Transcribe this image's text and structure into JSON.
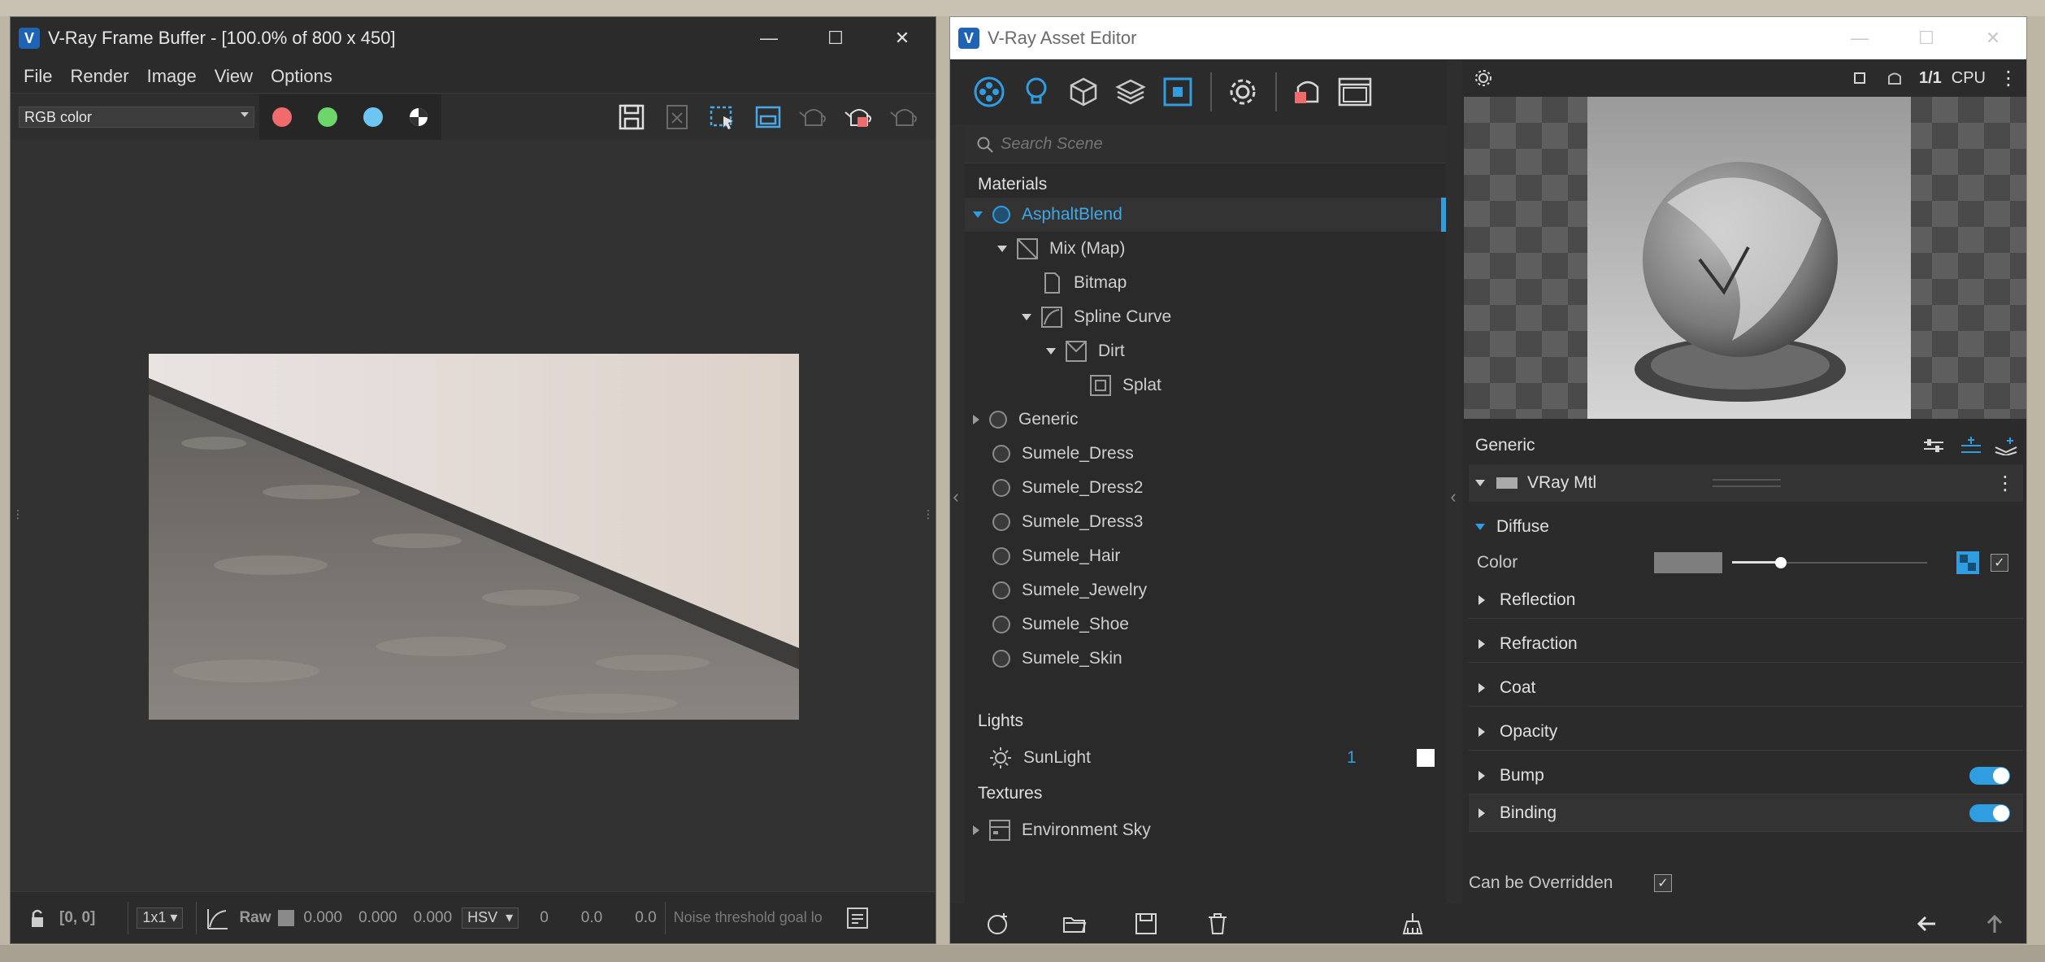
{
  "vfb": {
    "title": "V-Ray Frame Buffer - [100.0% of 800 x 450]",
    "menus": [
      "File",
      "Render",
      "Image",
      "View",
      "Options"
    ],
    "channel": "RGB color",
    "swatch_colors": [
      "#f06b6b",
      "#6cd66c",
      "#6cc6f0"
    ],
    "status": {
      "coords": "[0, 0]",
      "sampling": "1x1",
      "raw_label": "Raw",
      "v1": "0.000",
      "v2": "0.000",
      "v3": "0.000",
      "mode": "HSV",
      "h": "0",
      "s": "0.0",
      "v": "0.0",
      "message": "Noise threshold goal lo"
    }
  },
  "ae": {
    "title": "V-Ray Asset Editor",
    "search_placeholder": "Search Scene",
    "sections": {
      "materials": "Materials",
      "lights": "Lights",
      "textures": "Textures"
    },
    "tree": [
      {
        "label": "AsphaltBlend",
        "level": 0,
        "expanded": true,
        "selected": true,
        "icon": "material-circle-icon"
      },
      {
        "label": "Mix (Map)",
        "level": 1,
        "expanded": true,
        "icon": "mix-map-icon"
      },
      {
        "label": "Bitmap",
        "level": 2,
        "icon": "bitmap-icon"
      },
      {
        "label": "Spline Curve",
        "level": 2,
        "expanded": true,
        "icon": "curve-icon"
      },
      {
        "label": "Dirt",
        "level": 3,
        "expanded": true,
        "icon": "dirt-icon"
      },
      {
        "label": "Splat",
        "level": 4,
        "icon": "splat-icon"
      },
      {
        "label": "Generic",
        "level": 0,
        "collapsed": true,
        "icon": "material-circle-icon"
      },
      {
        "label": "Sumele_Dress",
        "level": 0,
        "icon": "material-circle-icon"
      },
      {
        "label": "Sumele_Dress2",
        "level": 0,
        "icon": "material-circle-icon"
      },
      {
        "label": "Sumele_Dress3",
        "level": 0,
        "icon": "material-circle-icon"
      },
      {
        "label": "Sumele_Hair",
        "level": 0,
        "icon": "material-circle-icon"
      },
      {
        "label": "Sumele_Jewelry",
        "level": 0,
        "icon": "material-circle-icon"
      },
      {
        "label": "Sumele_Shoe",
        "level": 0,
        "icon": "material-circle-icon"
      },
      {
        "label": "Sumele_Skin",
        "level": 0,
        "icon": "material-circle-icon"
      }
    ],
    "lights": [
      {
        "label": "SunLight",
        "count": "1"
      }
    ],
    "textures": [
      {
        "label": "Environment Sky"
      }
    ],
    "preview": {
      "render_mode": "CPU",
      "ratio": "1/1"
    },
    "props": {
      "material_name": "Generic",
      "layer": "VRay Mtl",
      "diffuse": "Diffuse",
      "color_label": "Color",
      "color_value": 0.25,
      "rollouts": [
        "Reflection",
        "Refraction",
        "Coat",
        "Opacity",
        "Bump",
        "Binding"
      ],
      "override_label": "Can be Overridden"
    },
    "accent": "#2f9de0"
  }
}
